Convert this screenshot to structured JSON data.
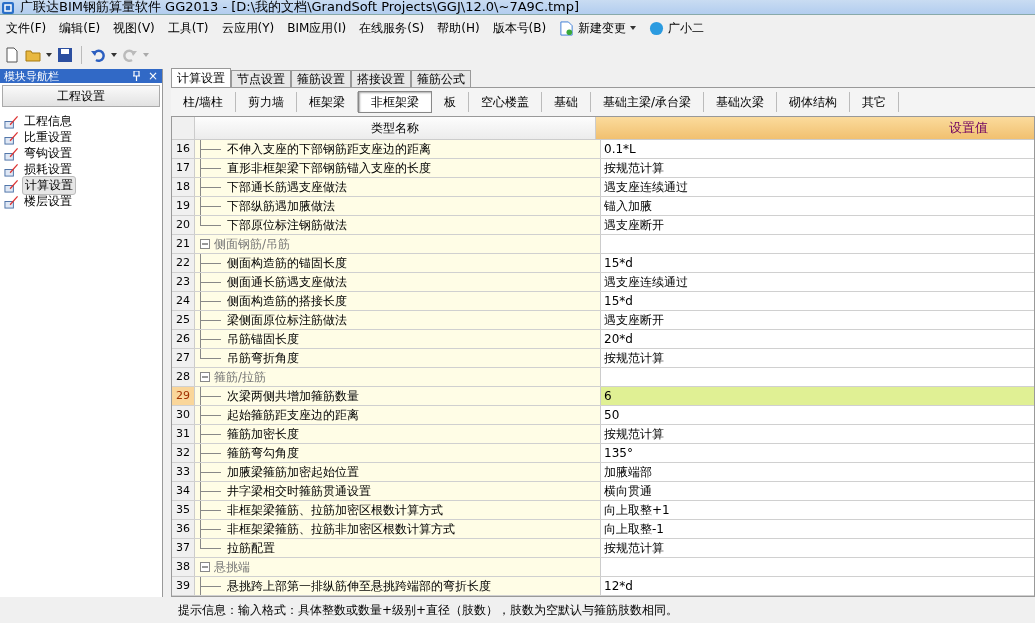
{
  "window": {
    "title": "广联达BIM钢筋算量软件 GG2013 - [D:\\我的文档\\GrandSoft Projects\\GGJ\\12.0\\~7A9C.tmp]"
  },
  "menu": [
    "文件(F)",
    "编辑(E)",
    "视图(V)",
    "工具(T)",
    "云应用(Y)",
    "BIM应用(I)",
    "在线服务(S)",
    "帮助(H)",
    "版本号(B)"
  ],
  "menu_extras": [
    {
      "kind": "change",
      "label": "新建变更"
    },
    {
      "kind": "helper",
      "label": "广小二"
    }
  ],
  "sidebar": {
    "title": "模块导航栏",
    "close": "×",
    "section": "工程设置",
    "items": [
      {
        "label": "工程信息",
        "selected": false
      },
      {
        "label": "比重设置",
        "selected": false
      },
      {
        "label": "弯钩设置",
        "selected": false
      },
      {
        "label": "损耗设置",
        "selected": false
      },
      {
        "label": "计算设置",
        "selected": true
      },
      {
        "label": "楼层设置",
        "selected": false
      }
    ]
  },
  "tabs": [
    {
      "label": "计算设置",
      "selected": true
    },
    {
      "label": "节点设置",
      "selected": false
    },
    {
      "label": "箍筋设置",
      "selected": false
    },
    {
      "label": "搭接设置",
      "selected": false
    },
    {
      "label": "箍筋公式",
      "selected": false
    }
  ],
  "subtabs": [
    {
      "label": "柱/墙柱",
      "selected": false
    },
    {
      "label": "剪力墙",
      "selected": false
    },
    {
      "label": "框架梁",
      "selected": false
    },
    {
      "label": "非框架梁",
      "selected": true
    },
    {
      "label": "板",
      "selected": false
    },
    {
      "label": "空心楼盖",
      "selected": false
    },
    {
      "label": "基础",
      "selected": false
    },
    {
      "label": "基础主梁/承台梁",
      "selected": false
    },
    {
      "label": "基础次梁",
      "selected": false
    },
    {
      "label": "砌体结构",
      "selected": false
    },
    {
      "label": "其它",
      "selected": false
    }
  ],
  "table": {
    "columns": [
      "类型名称",
      "设置值"
    ],
    "rows": [
      {
        "num": "16",
        "kind": "item",
        "name": "不伸入支座的下部钢筋距支座边的距离",
        "value": "0.1*L",
        "selected": false
      },
      {
        "num": "17",
        "kind": "item",
        "name": "直形非框架梁下部钢筋锚入支座的长度",
        "value": "按规范计算",
        "selected": false
      },
      {
        "num": "18",
        "kind": "item",
        "name": "下部通长筋遇支座做法",
        "value": "遇支座连续通过",
        "selected": false
      },
      {
        "num": "19",
        "kind": "item",
        "name": "下部纵筋遇加腋做法",
        "value": "锚入加腋",
        "selected": false
      },
      {
        "num": "20",
        "kind": "item",
        "name": "下部原位标注钢筋做法",
        "value": "遇支座断开",
        "selected": false
      },
      {
        "num": "21",
        "kind": "group",
        "name": "侧面钢筋/吊筋",
        "expanded": true,
        "selected": false
      },
      {
        "num": "22",
        "kind": "item",
        "name": "侧面构造筋的锚固长度",
        "value": "15*d",
        "selected": false
      },
      {
        "num": "23",
        "kind": "item",
        "name": "侧面通长筋遇支座做法",
        "value": "遇支座连续通过",
        "selected": false
      },
      {
        "num": "24",
        "kind": "item",
        "name": "侧面构造筋的搭接长度",
        "value": "15*d",
        "selected": false
      },
      {
        "num": "25",
        "kind": "item",
        "name": "梁侧面原位标注筋做法",
        "value": "遇支座断开",
        "selected": false
      },
      {
        "num": "26",
        "kind": "item",
        "name": "吊筋锚固长度",
        "value": "20*d",
        "selected": false
      },
      {
        "num": "27",
        "kind": "item",
        "name": "吊筋弯折角度",
        "value": "按规范计算",
        "selected": false
      },
      {
        "num": "28",
        "kind": "group",
        "name": "箍筋/拉筋",
        "expanded": true,
        "selected": false
      },
      {
        "num": "29",
        "kind": "item",
        "name": "次梁两侧共增加箍筋数量",
        "value": "6",
        "selected": true
      },
      {
        "num": "30",
        "kind": "item",
        "name": "起始箍筋距支座边的距离",
        "value": "50",
        "selected": false
      },
      {
        "num": "31",
        "kind": "item",
        "name": "箍筋加密长度",
        "value": "按规范计算",
        "selected": false
      },
      {
        "num": "32",
        "kind": "item",
        "name": "箍筋弯勾角度",
        "value": "135°",
        "selected": false
      },
      {
        "num": "33",
        "kind": "item",
        "name": "加腋梁箍筋加密起始位置",
        "value": "加腋端部",
        "selected": false
      },
      {
        "num": "34",
        "kind": "item",
        "name": "井字梁相交时箍筋贯通设置",
        "value": "横向贯通",
        "selected": false
      },
      {
        "num": "35",
        "kind": "item",
        "name": "非框架梁箍筋、拉筋加密区根数计算方式",
        "value": "向上取整+1",
        "selected": false
      },
      {
        "num": "36",
        "kind": "item",
        "name": "非框架梁箍筋、拉筋非加密区根数计算方式",
        "value": "向上取整-1",
        "selected": false
      },
      {
        "num": "37",
        "kind": "item",
        "name": "拉筋配置",
        "value": "按规范计算",
        "selected": false
      },
      {
        "num": "38",
        "kind": "group",
        "name": "悬挑端",
        "expanded": true,
        "selected": false
      },
      {
        "num": "39",
        "kind": "item",
        "name": "悬挑跨上部第一排纵筋伸至悬挑跨端部的弯折长度",
        "value": "12*d",
        "selected": false
      }
    ]
  },
  "status_bar": "提示信息：输入格式：具体整数或数量+级别+直径（肢数），肢数为空默认与箍筋肢数相同。"
}
